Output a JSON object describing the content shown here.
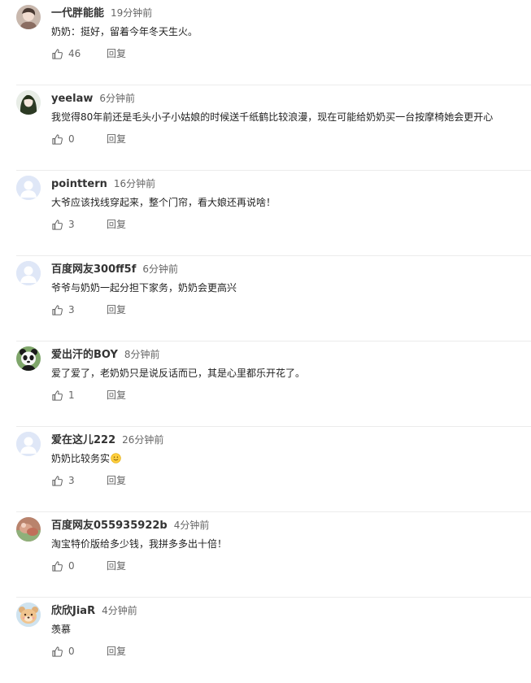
{
  "reply_label": "回复",
  "comments": [
    {
      "username": "一代胖能能",
      "time": "19分钟前",
      "text": "奶奶：挺好，留着今年冬天生火。",
      "likes": "46",
      "avatar_icon": "user-photo-avatar-icon"
    },
    {
      "username": "yeelaw",
      "time": "6分钟前",
      "text": "我觉得80年前还是毛头小子小姑娘的时候送千纸鹤比较浪漫，现在可能给奶奶买一台按摩椅她会更开心",
      "likes": "0",
      "avatar_icon": "user-photo-avatar-icon"
    },
    {
      "username": "pointtern",
      "time": "16分钟前",
      "text": "大爷应该找线穿起来，整个门帘，看大娘还再说啥！",
      "likes": "3",
      "avatar_icon": "default-avatar-icon"
    },
    {
      "username": "百度网友300ff5f",
      "time": "6分钟前",
      "text": "爷爷与奶奶一起分担下家务，奶奶会更高兴",
      "likes": "3",
      "avatar_icon": "default-avatar-icon"
    },
    {
      "username": "爱出汗的BOY",
      "time": "8分钟前",
      "text": "爱了爱了，老奶奶只是说反话而已，其是心里都乐开花了。",
      "likes": "1",
      "avatar_icon": "panda-avatar-icon"
    },
    {
      "username": "爱在这儿222",
      "time": "26分钟前",
      "text": "奶奶比较务实",
      "likes": "3",
      "avatar_icon": "default-avatar-icon",
      "emoji": "smile-emoji-icon"
    },
    {
      "username": "百度网友055935922b",
      "time": "4分钟前",
      "text": "淘宝特价版给多少钱，我拼多多出十倍！",
      "likes": "0",
      "avatar_icon": "user-photo-avatar-icon"
    },
    {
      "username": "欣欣JiaR",
      "time": "4分钟前",
      "text": "羡慕",
      "likes": "0",
      "avatar_icon": "cartoon-avatar-icon"
    }
  ]
}
